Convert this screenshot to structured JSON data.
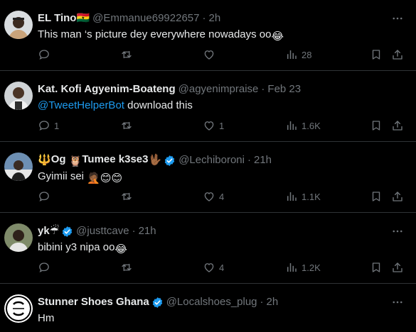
{
  "tweets": [
    {
      "name": "EL Tino",
      "name_suffix": "🇬🇭",
      "handle": "@Emmanue69922657",
      "time": "2h",
      "text": "This man ‘s picture dey everywhere nowadays oo",
      "text_suffix": "😂",
      "replies": "",
      "retweets": "",
      "likes": "",
      "views": "28"
    },
    {
      "name": "Kat. Kofi Agyenim-Boateng",
      "handle": "@agyenimpraise",
      "time": "Feb 23",
      "mention": "@TweetHelperBot",
      "text": " download this",
      "replies": "1",
      "retweets": "",
      "likes": "1",
      "views": "1.6K"
    },
    {
      "name_prefix": "🔱",
      "name": "Og ",
      "name_mid": "🦉",
      "name2": "Tumee k3se3",
      "name_suffix": "🖖🏾",
      "handle": "@Lechiboroni",
      "time": "21h",
      "text": "Gyimii sei ",
      "text_suffix": "🤦🏾😊😊",
      "replies": "",
      "retweets": "",
      "likes": "4",
      "views": "1.1K"
    },
    {
      "name": "yk",
      "name_suffix": "☔",
      "handle": "@justtcave",
      "time": "21h",
      "text": "bibini y3 nipa oo",
      "text_suffix": "😂",
      "replies": "",
      "retweets": "",
      "likes": "4",
      "views": "1.2K"
    },
    {
      "name": "Stunner Shoes Ghana",
      "handle": "@Localshoes_plug",
      "time": "2h",
      "text": "Hm"
    }
  ],
  "colors": {
    "background": "#000000",
    "text": "#e7e9ea",
    "muted": "#71767b",
    "accent": "#1d9bf0",
    "divider": "#2f3336"
  },
  "icons": [
    "more-icon",
    "reply-icon",
    "retweet-icon",
    "like-icon",
    "views-icon",
    "bookmark-icon",
    "share-icon",
    "verified-icon"
  ]
}
